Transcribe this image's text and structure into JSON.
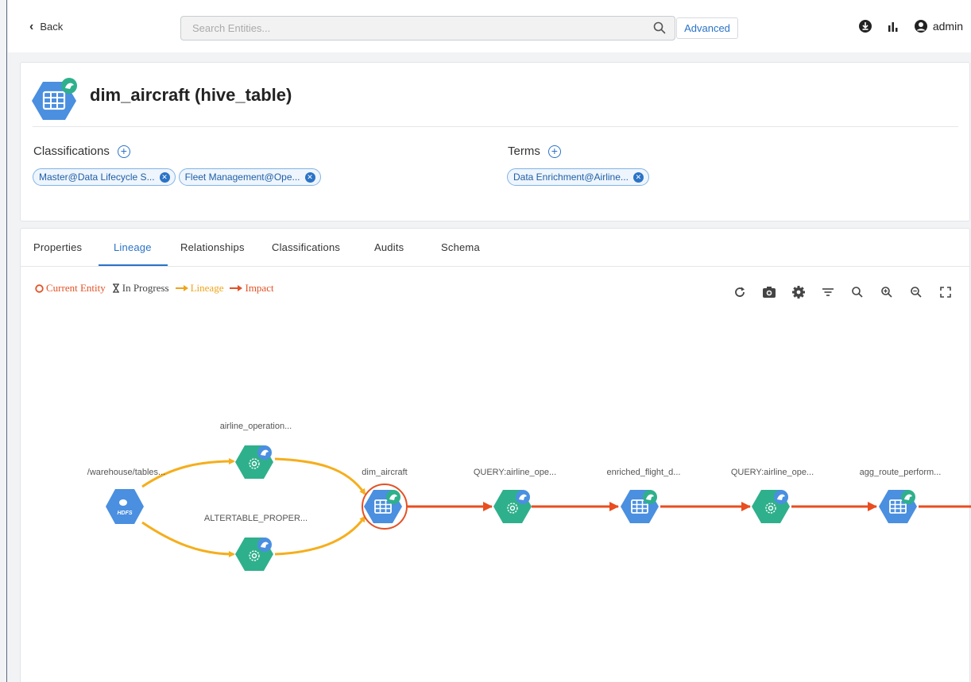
{
  "topbar": {
    "back_label": "Back",
    "search_placeholder": "Search Entities...",
    "advanced_label": "Advanced",
    "user_label": "admin"
  },
  "entity": {
    "title": "dim_aircraft (hive_table)",
    "classifications_label": "Classifications",
    "terms_label": "Terms",
    "classifications": [
      "Master@Data Lifecycle S...",
      "Fleet Management@Ope..."
    ],
    "terms": [
      "Data Enrichment@Airline..."
    ]
  },
  "tabs": [
    "Properties",
    "Lineage",
    "Relationships",
    "Classifications",
    "Audits",
    "Schema"
  ],
  "active_tab": "Lineage",
  "legend": {
    "current": "Current Entity",
    "progress": "In Progress",
    "lineage": "Lineage",
    "impact": "Impact"
  },
  "colors": {
    "lineage": "#f5ae1c",
    "impact": "#e94d20",
    "table_node": "#4a8fe0",
    "process_node": "#2fb08c",
    "accent": "#2a73c7"
  },
  "nodes": [
    {
      "id": "hdfs",
      "label": "/warehouse/tables...",
      "kind": "hdfs",
      "badge": "HDFS"
    },
    {
      "id": "p1",
      "label": "airline_operation...",
      "kind": "process"
    },
    {
      "id": "p2",
      "label": "ALTERTABLE_PROPER...",
      "kind": "process"
    },
    {
      "id": "dim",
      "label": "dim_aircraft",
      "kind": "table",
      "current": true
    },
    {
      "id": "q1",
      "label": "QUERY:airline_ope...",
      "kind": "process"
    },
    {
      "id": "enr",
      "label": "enriched_flight_d...",
      "kind": "table"
    },
    {
      "id": "q2",
      "label": "QUERY:airline_ope...",
      "kind": "process"
    },
    {
      "id": "agg",
      "label": "agg_route_perform...",
      "kind": "table"
    }
  ]
}
